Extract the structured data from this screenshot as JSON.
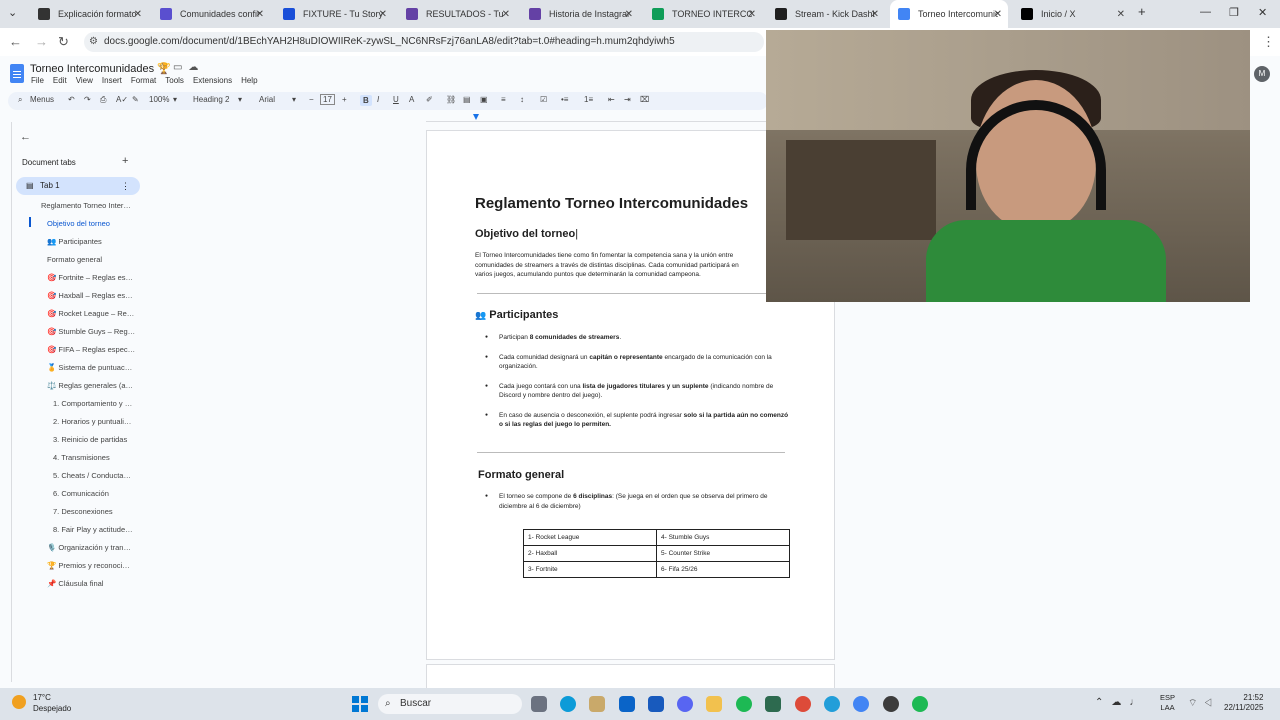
{
  "browser": {
    "tabs": [
      {
        "title": "Explicación formato t",
        "color": "#333333",
        "icon": "youtube-icon"
      },
      {
        "title": "Comunidades confirm",
        "color": "#5a4fcf",
        "icon": "forms-icon"
      },
      {
        "title": "FIXTURE - Tu Story",
        "color": "#1a4fd8",
        "icon": "twitch-icon"
      },
      {
        "title": "RESULTADOS - Tu St",
        "color": "#6441a5",
        "icon": "twitch-icon"
      },
      {
        "title": "Historia de Instagram",
        "color": "#6441a5",
        "icon": "twitch-icon"
      },
      {
        "title": "TORNEO INTERCOM",
        "color": "#0f9d58",
        "icon": "sheets-icon"
      },
      {
        "title": "Stream - Kick Dashbo",
        "color": "#1f1f1f",
        "icon": "kick-icon"
      },
      {
        "title": "Torneo Intercomunid",
        "color": "#4285f4",
        "icon": "docs-icon"
      },
      {
        "title": "Inicio / X",
        "color": "#000000",
        "icon": "x-icon"
      }
    ],
    "url": "docs.google.com/document/d/1BEchYAH2H8uDIOWIIReK-zywSL_NC6NRsFzj76anLA8/edit?tab=t.0#heading=h.mum2qhdyiwh5"
  },
  "docs": {
    "title": "Torneo Intercomunidades 🏆",
    "menu": [
      "File",
      "Edit",
      "View",
      "Insert",
      "Format",
      "Tools",
      "Extensions",
      "Help"
    ],
    "toolbar": {
      "menus": "Menus",
      "zoom": "100%",
      "style": "Heading 2",
      "font": "Arial",
      "size": "17"
    }
  },
  "sidebar": {
    "heading": "Document tabs",
    "tab_name": "Tab 1",
    "outline": [
      {
        "text": "Reglamento Torneo Inter…",
        "level": 1
      },
      {
        "text": "Objetivo del torneo",
        "level": 2,
        "selected": true
      },
      {
        "text": "👥 Participantes",
        "level": 2
      },
      {
        "text": "Formato general",
        "level": 2
      },
      {
        "text": "🎯 Fortnite – Reglas es…",
        "level": 2
      },
      {
        "text": "🎯 Haxball – Reglas es…",
        "level": 2
      },
      {
        "text": "🎯 Rocket League – Re…",
        "level": 2
      },
      {
        "text": "🎯 Stumble Guys – Reg…",
        "level": 2
      },
      {
        "text": "🎯 FIFA – Reglas espec…",
        "level": 2
      },
      {
        "text": "🏅 Sistema de puntuac…",
        "level": 2
      },
      {
        "text": "⚖️ Reglas generales (a…",
        "level": 2
      },
      {
        "text": "1. Comportamiento y …",
        "level": 3
      },
      {
        "text": "2. Horarios y puntuali…",
        "level": 3
      },
      {
        "text": "3. Reinicio de partidas",
        "level": 3
      },
      {
        "text": "4. Transmisiones",
        "level": 3
      },
      {
        "text": "5. Cheats / Conducta…",
        "level": 3
      },
      {
        "text": "6. Comunicación",
        "level": 3
      },
      {
        "text": "7. Desconexiones",
        "level": 3
      },
      {
        "text": "8. Fair Play y actitude…",
        "level": 3
      },
      {
        "text": "🎙️ Organización y tran…",
        "level": 2
      },
      {
        "text": "🏆 Premios y reconoci…",
        "level": 2
      },
      {
        "text": "📌 Cláusula final",
        "level": 2
      }
    ]
  },
  "document": {
    "h1": "Reglamento Torneo Intercomunidades",
    "objetivo_title": "Objetivo del torneo",
    "objetivo_lines": [
      "El Torneo Intercomunidades tiene como fin fomentar la competencia sana y la unión entre",
      "comunidades de streamers a través de distintas disciplinas. Cada comunidad participará en",
      "varios juegos, acumulando puntos que determinarán la comunidad campeona."
    ],
    "participantes_title": "Participantes",
    "participantes_items": [
      {
        "pre": "Participan ",
        "bold": "8 comunidades de streamers",
        "post": "."
      },
      {
        "pre": "Cada comunidad designará un ",
        "bold": "capitán o representante",
        "post": " encargado de la comunicación con la organización."
      },
      {
        "pre": "Cada juego contará con una ",
        "bold": "lista de jugadores titulares y un suplente",
        "post": " (indicando nombre de Discord y nombre dentro del juego)."
      },
      {
        "pre": "En caso de ausencia o desconexión, el suplente podrá ingresar ",
        "bold": "solo si la partida aún no comenzó o si las reglas del juego lo permiten.",
        "post": ""
      }
    ],
    "formato_title": "Formato general",
    "formato_items": [
      {
        "pre": "El torneo se compone de ",
        "bold": "6 disciplinas",
        "post": ": (Se juega en el orden que se observa del primero de diciembre al 6 de diciembre)"
      }
    ],
    "disciplinas_table": [
      [
        "1- Rocket League",
        "4- Stumble Guys"
      ],
      [
        "2- Haxball",
        "5- Counter Strike"
      ],
      [
        "3- Fortnite",
        "6- Fifa 25/26"
      ]
    ]
  },
  "taskbar": {
    "weather_temp": "17°C",
    "weather_cond": "Despejado",
    "search": "Buscar",
    "lang_1": "ESP",
    "lang_2": "LAA",
    "time": "21:52",
    "date": "22/11/2025"
  }
}
